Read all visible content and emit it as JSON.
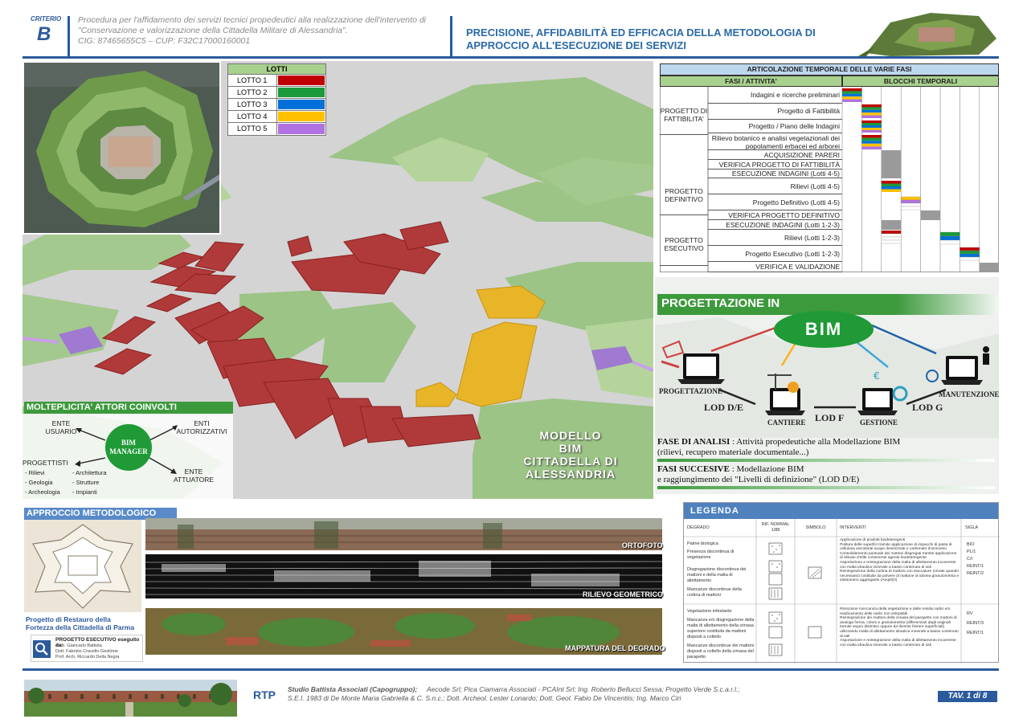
{
  "header": {
    "criterio_label": "CRITERIO",
    "criterio_letter": "B",
    "procedure_line1": "Procedura per l'affidamento dei servizi tecnici propedeutici alla realizzazione dell'intervento di",
    "procedure_line2": "\"Conservazione e valorizzazione della Cittadella Militare di Alessandria\".",
    "procedure_line3": "CIG: 87465655C5 – CUP: F32C17000160001",
    "title_line1": "PRECISIONE, AFFIDABILITÀ ED EFFICACIA DELLA METODOLOGIA DI",
    "title_line2": "APPROCCIO ALL'ESECUZIONE DEI SERVIZI"
  },
  "lotti": {
    "title": "LOTTI",
    "items": [
      {
        "label": "LOTTO 1",
        "color": "#c00000"
      },
      {
        "label": "LOTTO 2",
        "color": "#1a9a3a"
      },
      {
        "label": "LOTTO 3",
        "color": "#0070d8"
      },
      {
        "label": "LOTTO 4",
        "color": "#ffc000"
      },
      {
        "label": "LOTTO 5",
        "color": "#b072e0"
      }
    ]
  },
  "actors": {
    "banner": "MOLTEPLICITA' ATTORI COINVOLTI",
    "center": "BIM MANAGER",
    "ente_usuario": "ENTE USUARIO",
    "enti_autorizzativi": "ENTI AUTORIZZATIVI",
    "ente_attuatore": "ENTE ATTUATORE",
    "progettisti": "PROGETTISTI",
    "disciplines_a": [
      "- Rilievi",
      "- Geologia",
      "- Archeologia"
    ],
    "disciplines_b": [
      "- Architettura",
      "- Strutture",
      "- Impianti"
    ]
  },
  "model_title": [
    "MODELLO",
    "BIM",
    "CITTADELLA DI",
    "ALESSANDRIA"
  ],
  "timeline": {
    "title": "ARTICOLAZIONE TEMPORALE DELLE VARIE FASI",
    "col1": "FASI / ATTIVITA'",
    "col2": "BLOCCHI TEMPORALI",
    "group1": "PROGETTO DI FATTIBILITA'",
    "group2": "PROGETTO DEFINITIVO",
    "group3": "PROGETTO ESECUTIVO",
    "rows": [
      "Indagini e ricerche preliminari",
      "Progetto di Fattibilità",
      "Progetto / Piano delle Indagini",
      "Rilievo botanico e analisi vegetazionali dei popolamenti erbacei ed arborei",
      "ACQUISIZIONE PARERI",
      "VERIFICA PROGETTO DI FATTIBILITÀ",
      "ESECUZIONE INDAGINI (Lotti 4-5)",
      "Rilievi (Lotti 4-5)",
      "Progetto Definitivo (Lotti 4-5)",
      "VERIFICA PROGETTO DEFINITIVO",
      "ESECUZIONE INDAGINI (Lotti 1-2-3)",
      "Rilievi (Lotti 1-2-3)",
      "Progetto Esecutivo (Lotti 1-2-3)",
      "VERIFICA E VALIDAZIONE"
    ]
  },
  "bim": {
    "banner": "PROGETTAZIONE IN",
    "oval": "BIM",
    "progettazione": "PROGETTAZIONE",
    "cantiere": "CANTIERE",
    "gestione": "GESTIONE",
    "manutenzione": "MANUTENZIONE",
    "lod_de": "LOD D/E",
    "lod_f": "LOD F",
    "lod_g": "LOD G",
    "fase_analisi_title": "FASE DI ANALISI",
    "fase_analisi_text": " : Attività propedeutiche alla Modellazione BIM",
    "fase_analisi_text2": "(rilievi, recupero materiale documentale...)",
    "fasi_succ_title": "FASI SUCCESIVE",
    "fasi_succ_text": " : Modellazione BIM",
    "fasi_succ_text2": "e raggiungimento dei \"Livelli di definizione\" (LOD D/E)"
  },
  "approach": {
    "banner": "APPROCCIO METODOLOGICO",
    "ortofoto": "ORTOFOTO",
    "rilievo": "RILIEVO GEOMETRICO",
    "mappatura": "MAPPATURA DEL DEGRADO",
    "restauro_line1": "Progetto di Restauro della",
    "restauro_line2": "Fortezza della Cittadella di Parma",
    "esecutivo_title": "PROGETTO ESECUTIVO eseguito da:",
    "esecutivo_names": [
      "Arch. Giancarlo Battista",
      "Dott. Fabrizio Cravello Gestione",
      "Prof. Arch. Riccardo Della Negra"
    ]
  },
  "legend": {
    "title": "LEGENDA",
    "headers": [
      "DEGRADO",
      "RIF. NORMAL 1/88",
      "SIMBOLO",
      "INTERVENTI",
      "SIGLA"
    ],
    "degrado1": [
      "Patine biologica",
      "Presenza discontinua di vegetazione",
      "Disgregazione discontinua dei mattoni e della malta di allettamento",
      "Mancanze discontinue della cortina di mattoni"
    ],
    "interventi1": [
      "Applicazione di prodotti biodeteregenti",
      "Pulitura delle superfici tramite applicazione di impacchi di pasta di cellulosa veicolante acque deionizzate e carbonato d'ammonio",
      "Consolidamento puntuale dei mattoni disgregati tramite applicazione di silicato d'etile contenente agente biodeteregente",
      "Asportazione e reintegrazione della malta di allettamento incoerente con malta idraulica minerale a basso contenuto di sali",
      "Reintegrazione della cortina di mattoni con stuccature (ornate quando necessario) costituite da polvere di mattone di idonea granulometria e elastomero aggregante (Aeqel(O)"
    ],
    "sigle1": [
      "BIO",
      "PL/1",
      "C/I",
      "REINT/1",
      "REINT/2"
    ],
    "degrado2": [
      "Vegetazione infestante",
      "Mancanza e/o disgregazione della malta di allettamento della cimasa superiore costituita da mattoni disposti a coltello",
      "Mancanze discontinue dei mattoni disposti a coltello della cimasa del parapetto"
    ],
    "interventi2": [
      "Rimozione meccanica della vegetazione e delle residui radici e/o eradicamento delle radici non estirpabili",
      "Reintegrazione dei mattoni della cimasa del parapetto con mattoni di analoga forma, colore e granulometria (differenziati dagli originali tramite segno distintivo oppure da diverse finiture superficiali) utilizzando malta di allettamento idraulica minerale a basso contenuto di sali",
      "Asportazione e reintegrazione della malta di allettamento incoerente con malta idraulica minerale a basso contenuto di sali"
    ],
    "sigle2": [
      "RV",
      "REINT/3",
      "REINT/1"
    ]
  },
  "footer": {
    "rtp": "RTP",
    "line1_lead": "Studio Battista Associati (Capogruppo);",
    "line1_rest": "Aecode Srl;      Pica Ciamarra Associati - PCAInt Srl;      Ing. Roberto Bellucci Sessa;      Progetto Verde S.c.a.r.l.;",
    "line2": "S.E.I. 1983 di De Monte Maria Gabriella & C. S.n.c.;      Dott. Archeol. Lester Lonardo;      Dott. Geol. Fabio De Vincentiis;      Ing. Marco Ciri",
    "tav": "TAV. 1 di 8"
  }
}
